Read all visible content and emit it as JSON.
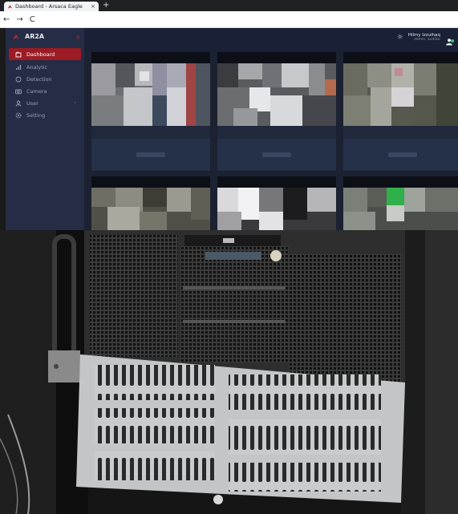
{
  "browser": {
    "tab_title": "Dashboard - Arsaca Eagle",
    "close_glyph": "×",
    "new_tab_glyph": "+",
    "back_glyph": "←",
    "forward_glyph": "→",
    "reload_glyph": "C"
  },
  "app": {
    "brand_name": "AR2A",
    "accent_color": "#9c1b24",
    "menu": [
      {
        "label": "Dashboard",
        "icon": "folder-icon",
        "active": true
      },
      {
        "label": "Analytic",
        "icon": "bar-chart-icon",
        "active": false
      },
      {
        "label": "Detection",
        "icon": "circle-icon",
        "active": false
      },
      {
        "label": "Camera",
        "icon": "camera-icon",
        "active": false
      },
      {
        "label": "User",
        "icon": "user-icon",
        "active": false,
        "has_submenu": true
      },
      {
        "label": "Setting",
        "icon": "gear-icon",
        "active": false
      }
    ],
    "user": {
      "name": "Hilmy Izzulhaq",
      "role": "admin, auditor"
    }
  },
  "cameras_count_visible": 6
}
